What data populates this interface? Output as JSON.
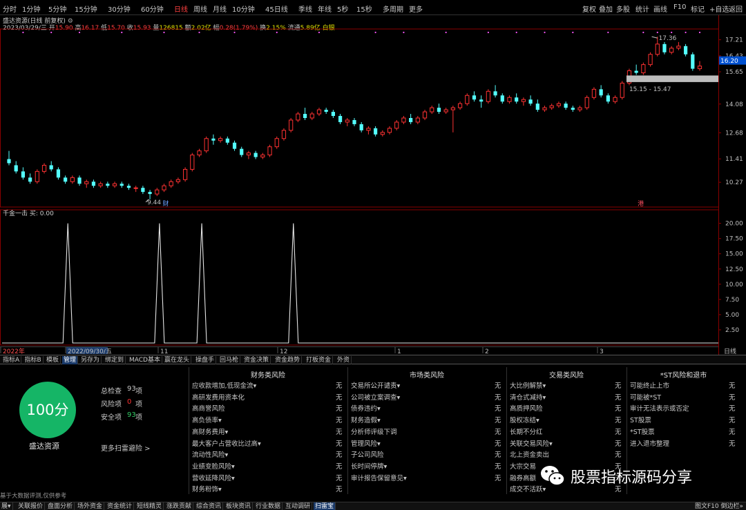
{
  "periods": [
    {
      "label": "分时",
      "active": false
    },
    {
      "label": "1分钟",
      "active": false
    },
    {
      "label": "5分钟",
      "active": false
    },
    {
      "label": "15分钟",
      "active": false
    },
    {
      "label": "30分钟",
      "active": false
    },
    {
      "label": "60分钟",
      "active": false
    },
    {
      "label": "日线",
      "active": true
    },
    {
      "label": "周线",
      "active": false
    },
    {
      "label": "月线",
      "active": false
    },
    {
      "label": "10分钟",
      "active": false
    },
    {
      "label": "45日线",
      "active": false
    },
    {
      "label": "季线",
      "active": false
    },
    {
      "label": "年线",
      "active": false
    },
    {
      "label": "5秒",
      "active": false
    },
    {
      "label": "15秒",
      "active": false
    },
    {
      "label": "多周期",
      "active": false
    },
    {
      "label": "更多",
      "active": false
    }
  ],
  "toolbar": [
    "复权",
    "叠加",
    "多股",
    "统计",
    "画线",
    "F10",
    "标记",
    "+自选",
    "返回"
  ],
  "title": "盛达资源(日线 前复权)",
  "quote": {
    "date": "2023/03/29/三",
    "open_label": "开",
    "open": "15.90",
    "high_label": "高",
    "high": "16.17",
    "low_label": "低",
    "low": "15.70",
    "close_label": "收",
    "close": "15.93",
    "vol_label": "量",
    "vol": "126815",
    "amount_label": "额",
    "amount": "2.02亿",
    "change_label": "幅",
    "change": "0.28(1.79%)",
    "turnover_label": "换",
    "turnover": "2.15%",
    "float_label": "流通",
    "float": "5.89亿",
    "sector": "白银"
  },
  "price_axis": [
    "17.21",
    "16.43",
    "15.65",
    "14.08",
    "12.68",
    "11.41",
    "10.27"
  ],
  "current_price": "16.20",
  "annotations": {
    "high_mark": "17.36",
    "low_mark": "9.44",
    "zone": "15.15 - 15.47",
    "cai_marker": "财",
    "gang_marker": "港"
  },
  "indicator": {
    "name": "千金一击",
    "label": "买: 0.00",
    "axis": [
      "20.00",
      "17.50",
      "15.00",
      "12.50",
      "10.00",
      "7.50",
      "5.00",
      "2.50"
    ]
  },
  "date_axis": [
    "2022年",
    "2022/09/30/五",
    "11",
    "12",
    "1",
    "2",
    "3"
  ],
  "date_axis_right": "日线",
  "chart_data": {
    "type": "candlestick",
    "title": "盛达资源(日线 前复权)",
    "ylim": [
      9.2,
      17.6
    ],
    "candles": [
      [
        11.4,
        11.8,
        11.2,
        11.1
      ],
      [
        11.1,
        11.3,
        10.8,
        10.7
      ],
      [
        10.8,
        11.0,
        10.5,
        10.4
      ],
      [
        10.5,
        10.7,
        10.3,
        10.2
      ],
      [
        10.3,
        10.9,
        10.8,
        10.2
      ],
      [
        10.8,
        11.2,
        11.1,
        10.7
      ],
      [
        11.1,
        11.3,
        10.9,
        10.8
      ],
      [
        10.9,
        11.0,
        10.5,
        10.4
      ],
      [
        10.5,
        10.6,
        10.3,
        10.2
      ],
      [
        10.3,
        10.6,
        10.5,
        10.2
      ],
      [
        10.5,
        10.6,
        10.2,
        10.1
      ],
      [
        10.2,
        10.4,
        10.3,
        10.0
      ],
      [
        10.3,
        10.4,
        10.1,
        10.0
      ],
      [
        10.1,
        10.3,
        10.2,
        10.0
      ],
      [
        10.2,
        10.3,
        10.1,
        10.0
      ],
      [
        10.1,
        10.3,
        10.2,
        10.0
      ],
      [
        10.2,
        10.3,
        10.1,
        10.0
      ],
      [
        10.1,
        10.2,
        10.0,
        9.9
      ],
      [
        10.0,
        10.1,
        10.0,
        9.8
      ],
      [
        10.0,
        10.1,
        9.8,
        9.7
      ],
      [
        9.8,
        9.9,
        9.7,
        9.44
      ],
      [
        9.7,
        10.0,
        9.9,
        9.6
      ],
      [
        9.9,
        10.2,
        10.1,
        9.8
      ],
      [
        10.1,
        10.4,
        10.3,
        10.0
      ],
      [
        10.3,
        10.5,
        10.4,
        10.2
      ],
      [
        10.4,
        11.0,
        10.9,
        10.3
      ],
      [
        10.9,
        11.7,
        11.6,
        10.8
      ],
      [
        11.6,
        11.9,
        11.8,
        11.5
      ],
      [
        11.8,
        12.5,
        12.4,
        11.7
      ],
      [
        12.4,
        12.6,
        12.3,
        12.1
      ],
      [
        12.3,
        12.5,
        12.4,
        12.2
      ],
      [
        12.4,
        12.5,
        12.2,
        12.1
      ],
      [
        12.2,
        12.3,
        11.9,
        11.8
      ],
      [
        11.9,
        12.0,
        11.6,
        11.5
      ],
      [
        11.6,
        11.8,
        11.7,
        11.4
      ],
      [
        11.7,
        11.8,
        11.5,
        11.4
      ],
      [
        11.5,
        11.7,
        11.6,
        11.4
      ],
      [
        11.6,
        12.1,
        12.0,
        11.5
      ],
      [
        12.0,
        12.5,
        12.4,
        11.9
      ],
      [
        12.4,
        12.9,
        12.8,
        12.3
      ],
      [
        12.8,
        13.4,
        13.3,
        12.7
      ],
      [
        13.3,
        13.7,
        13.6,
        13.2
      ],
      [
        13.6,
        13.9,
        13.4,
        13.3
      ],
      [
        13.4,
        13.7,
        13.6,
        13.3
      ],
      [
        13.6,
        13.9,
        13.8,
        13.5
      ],
      [
        13.8,
        13.9,
        13.7,
        13.6
      ],
      [
        13.7,
        13.8,
        13.5,
        13.4
      ],
      [
        13.5,
        13.6,
        13.2,
        13.1
      ],
      [
        13.2,
        13.4,
        13.3,
        13.0
      ],
      [
        13.3,
        13.4,
        13.1,
        13.0
      ],
      [
        13.1,
        13.2,
        12.8,
        12.7
      ],
      [
        12.8,
        13.0,
        12.9,
        12.6
      ],
      [
        12.9,
        13.0,
        12.6,
        12.5
      ],
      [
        12.6,
        12.8,
        12.7,
        12.5
      ],
      [
        12.7,
        13.0,
        12.9,
        12.6
      ],
      [
        12.9,
        13.3,
        13.2,
        12.8
      ],
      [
        13.2,
        13.5,
        13.4,
        13.1
      ],
      [
        13.4,
        13.6,
        13.2,
        13.1
      ],
      [
        13.2,
        13.5,
        13.4,
        13.1
      ],
      [
        13.4,
        13.8,
        13.7,
        13.3
      ],
      [
        13.7,
        14.0,
        13.9,
        13.6
      ],
      [
        13.9,
        14.1,
        13.7,
        13.6
      ],
      [
        13.7,
        13.9,
        13.8,
        13.6
      ],
      [
        13.8,
        14.0,
        13.9,
        12.7
      ],
      [
        13.9,
        14.2,
        14.1,
        13.8
      ],
      [
        14.1,
        14.6,
        14.5,
        14.0
      ],
      [
        14.5,
        14.7,
        14.3,
        14.2
      ],
      [
        14.3,
        14.5,
        14.2,
        13.9
      ],
      [
        14.2,
        14.8,
        14.7,
        14.1
      ],
      [
        14.7,
        15.0,
        14.5,
        14.4
      ],
      [
        14.5,
        14.6,
        14.2,
        14.1
      ],
      [
        14.2,
        14.5,
        14.4,
        14.1
      ],
      [
        14.4,
        14.6,
        14.2,
        14.1
      ],
      [
        14.2,
        14.4,
        14.3,
        14.0
      ],
      [
        14.3,
        14.5,
        14.1,
        14.0
      ],
      [
        14.1,
        14.3,
        13.8,
        13.7
      ],
      [
        13.8,
        14.0,
        13.9,
        13.7
      ],
      [
        13.9,
        14.1,
        14.0,
        13.8
      ],
      [
        14.0,
        14.2,
        14.1,
        13.9
      ],
      [
        14.1,
        14.2,
        13.9,
        13.8
      ],
      [
        13.9,
        14.0,
        13.8,
        13.7
      ],
      [
        13.8,
        14.0,
        13.9,
        13.7
      ],
      [
        13.9,
        14.5,
        14.4,
        13.8
      ],
      [
        14.4,
        14.9,
        14.8,
        14.3
      ],
      [
        14.8,
        15.0,
        14.5,
        14.4
      ],
      [
        14.5,
        14.6,
        14.2,
        14.1
      ],
      [
        14.2,
        14.5,
        14.4,
        14.1
      ],
      [
        14.4,
        15.2,
        15.1,
        14.3
      ],
      [
        15.1,
        15.8,
        15.7,
        15.0
      ],
      [
        15.7,
        16.0,
        15.6,
        15.5
      ],
      [
        15.6,
        16.1,
        16.0,
        15.5
      ],
      [
        16.0,
        16.6,
        16.5,
        15.9
      ],
      [
        16.5,
        17.36,
        17.0,
        16.4
      ],
      [
        17.0,
        17.1,
        16.6,
        16.5
      ],
      [
        16.6,
        16.9,
        16.8,
        16.5
      ],
      [
        16.8,
        17.1,
        16.9,
        16.7
      ],
      [
        16.9,
        17.0,
        16.5,
        16.4
      ],
      [
        16.5,
        16.6,
        15.8,
        15.7
      ],
      [
        15.8,
        16.17,
        15.93,
        15.7
      ]
    ],
    "indicator_series": {
      "name": "千金一击",
      "peaks": [
        {
          "index": 6,
          "value": 20
        },
        {
          "index": 19,
          "value": 20
        },
        {
          "index": 25,
          "value": 20
        },
        {
          "index": 38,
          "value": 20
        }
      ],
      "ylim": [
        0,
        22
      ]
    }
  },
  "tabs": [
    {
      "label": "指标A",
      "active": false
    },
    {
      "label": "指标B",
      "active": false
    },
    {
      "label": "模板",
      "active": false
    },
    {
      "label": "管理",
      "active": true
    },
    {
      "label": "另存为",
      "active": false
    },
    {
      "label": "绑定到",
      "active": false
    },
    {
      "label": "MACD基本",
      "active": false
    },
    {
      "label": "赢在龙头",
      "active": false
    },
    {
      "label": "操盘手",
      "active": false
    },
    {
      "label": "回马枪",
      "active": false
    },
    {
      "label": "资金决策",
      "active": false
    },
    {
      "label": "资金趋势",
      "active": false
    },
    {
      "label": "打板资金",
      "active": false
    },
    {
      "label": "外资",
      "active": false
    }
  ],
  "risk": {
    "score": "100分",
    "stock_name": "盛达资源",
    "total_label": "总检查",
    "total_val": "93",
    "total_unit": "项",
    "risk_label": "风险项",
    "risk_val": "0",
    "risk_unit": "项",
    "safe_label": "安全项",
    "safe_val": "93",
    "safe_unit": "项",
    "more_link": "更多扫雷避险 >",
    "footnote": "基于大数据评测,仅供参考",
    "colors": {
      "score_bg": "#15b566",
      "risk_val": "#ff3333",
      "safe_val": "#33cc66"
    },
    "columns": [
      {
        "header": "财务类风险",
        "rows": [
          {
            "item": "应收款增加,低现金流▾",
            "result": "无"
          },
          {
            "item": "高研发费用资本化",
            "result": "无"
          },
          {
            "item": "高商誉风险",
            "result": "无"
          },
          {
            "item": "高负债率▾",
            "result": "无"
          },
          {
            "item": "高财务费用▾",
            "result": "无"
          },
          {
            "item": "最大客户占营收比过高▾",
            "result": "无"
          },
          {
            "item": "流动性风险▾",
            "result": "无"
          },
          {
            "item": "业绩变脸风险▾",
            "result": "无"
          },
          {
            "item": "营收延降风险▾",
            "result": "无"
          },
          {
            "item": "财务粉饰▾",
            "result": "无"
          }
        ]
      },
      {
        "header": "市场类风险",
        "rows": [
          {
            "item": "交易所公开谴责▾",
            "result": "无"
          },
          {
            "item": "公司被立案调查▾",
            "result": "无"
          },
          {
            "item": "债券违约▾",
            "result": "无"
          },
          {
            "item": "财务造假▾",
            "result": "无"
          },
          {
            "item": "分析师评级下调",
            "result": "无"
          },
          {
            "item": "管理风险▾",
            "result": "无"
          },
          {
            "item": "子公司风险",
            "result": "无"
          },
          {
            "item": "长时间停牌▾",
            "result": "无"
          },
          {
            "item": "审计报告保留意见▾",
            "result": "无"
          }
        ]
      },
      {
        "header": "交易类风险",
        "rows": [
          {
            "item": "大比例解禁▾",
            "result": "无"
          },
          {
            "item": "清仓式减持▾",
            "result": "无"
          },
          {
            "item": "高质押风险",
            "result": "无"
          },
          {
            "item": "股权冻结▾",
            "result": "无"
          },
          {
            "item": "长期不分红",
            "result": "无"
          },
          {
            "item": "关联交易风险▾",
            "result": "无"
          },
          {
            "item": "北上资金卖出",
            "result": "无"
          },
          {
            "item": "大宗交易",
            "result": "无"
          },
          {
            "item": "融券高额",
            "result": "无"
          },
          {
            "item": "成交不活跃▾",
            "result": "无"
          }
        ]
      },
      {
        "header": "*ST风险和退市",
        "rows": [
          {
            "item": "可能终止上市",
            "result": "无"
          },
          {
            "item": "可能被*ST",
            "result": "无"
          },
          {
            "item": "审计无法表示或否定",
            "result": "无"
          },
          {
            "item": "ST股票",
            "result": "无"
          },
          {
            "item": "*ST股票",
            "result": "无"
          },
          {
            "item": "进入退市整理",
            "result": "无"
          }
        ]
      }
    ]
  },
  "bottom_tabs": [
    {
      "label": "展▾",
      "active": false
    },
    {
      "label": "关联报价",
      "active": false
    },
    {
      "label": "盘面分析",
      "active": false
    },
    {
      "label": "场外资金",
      "active": false
    },
    {
      "label": "资金统计",
      "active": false
    },
    {
      "label": "短线精灵",
      "active": false
    },
    {
      "label": "涨跌贡献",
      "active": false
    },
    {
      "label": "综合资讯",
      "active": false
    },
    {
      "label": "板块资讯",
      "active": false
    },
    {
      "label": "行业数据",
      "active": false
    },
    {
      "label": "互动调研",
      "active": false
    },
    {
      "label": "扫雷宝",
      "active": true
    }
  ],
  "bottom_right": "图文F10 倒边栏»",
  "watermark": "股票指标源码分享",
  "colors": {
    "up": "#ff3232",
    "down": "#54ffff",
    "grid": "#8a0000",
    "marker": "#ff55ff",
    "zone": "#bdbdbd",
    "text": "#c8c8c8"
  }
}
